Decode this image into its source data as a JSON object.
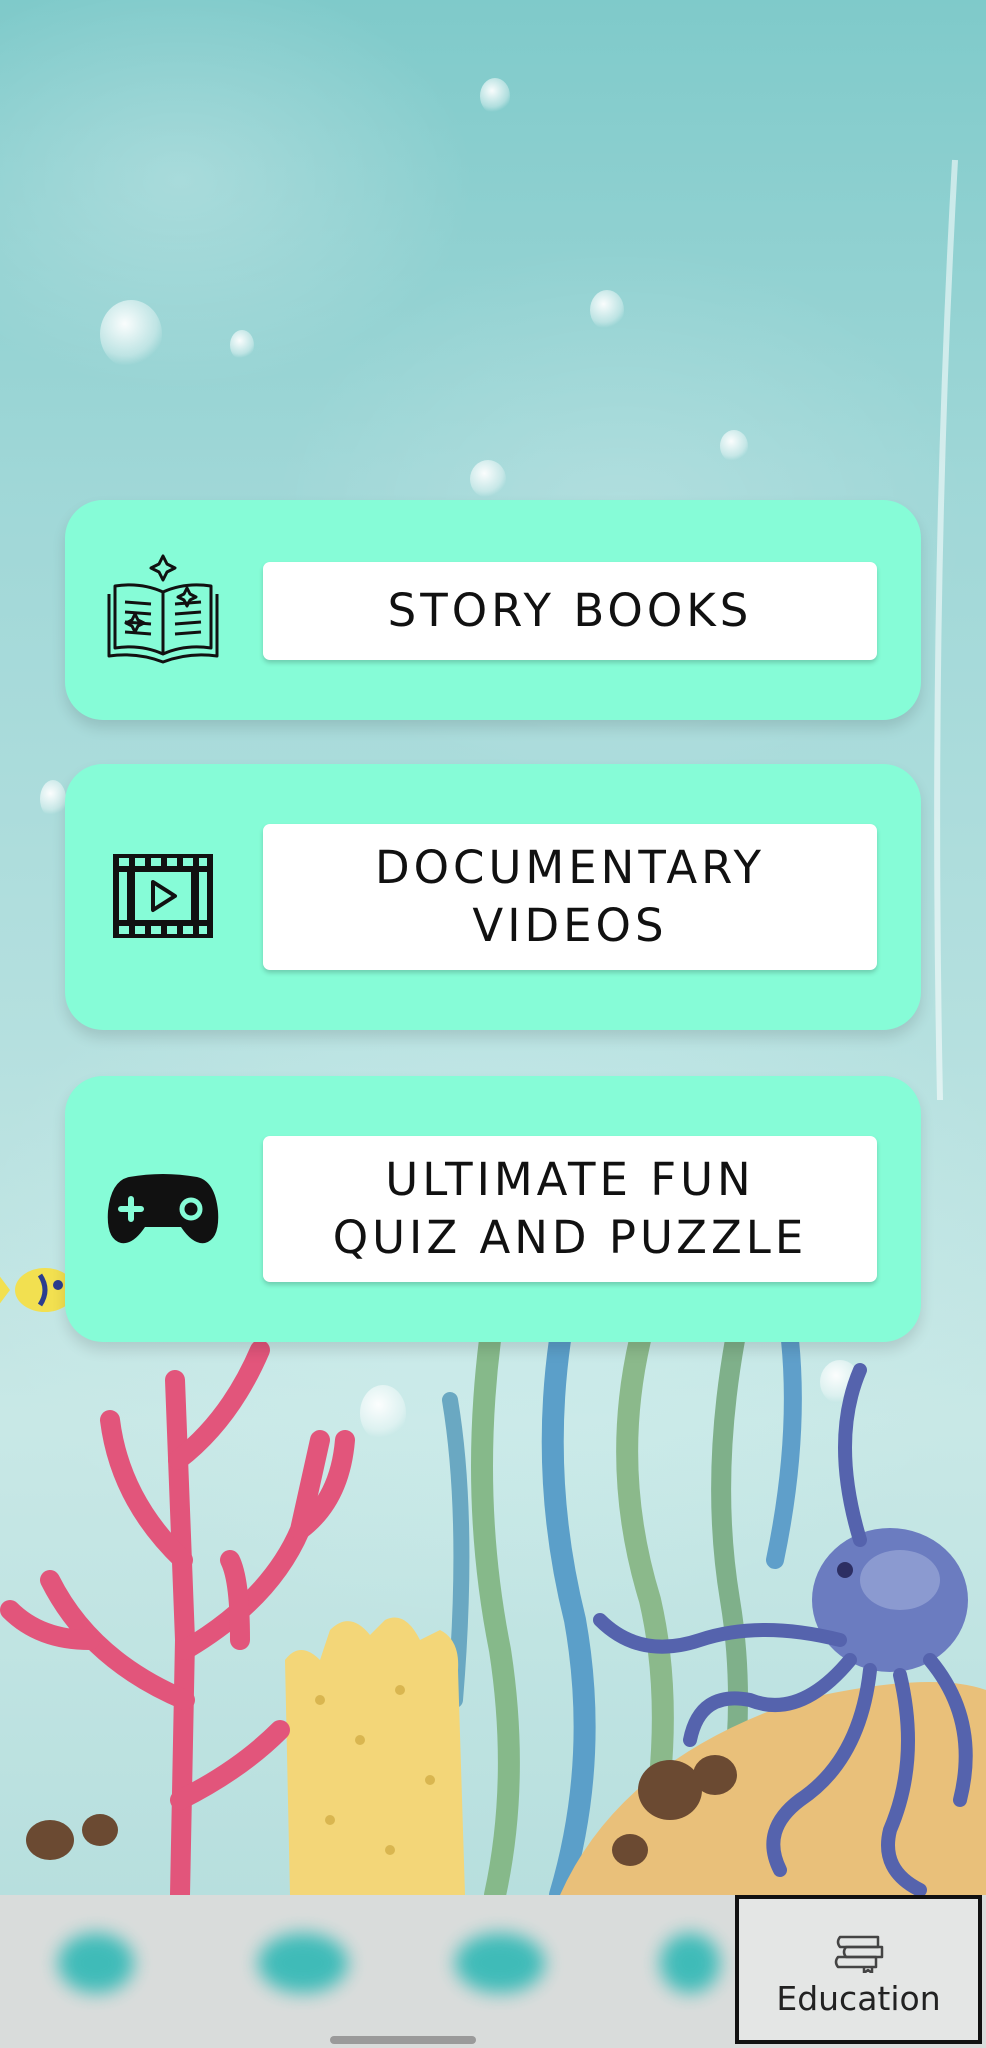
{
  "menu": {
    "items": [
      {
        "label": "STORY BOOKS",
        "icon": "open-book-icon"
      },
      {
        "label": "DOCUMENTARY\nVIDEOS",
        "icon": "film-play-icon"
      },
      {
        "label": "ULTIMATE FUN\nQUIZ AND PUZZLE",
        "icon": "gamepad-icon"
      }
    ]
  },
  "bottom_nav": {
    "active_label": "Education",
    "active_icon": "books-icon"
  },
  "colors": {
    "card": "#86fcd7",
    "label_background": "#ffffff",
    "nav_background": "#d9dcdb",
    "nav_blur": "#2fb8b5"
  }
}
